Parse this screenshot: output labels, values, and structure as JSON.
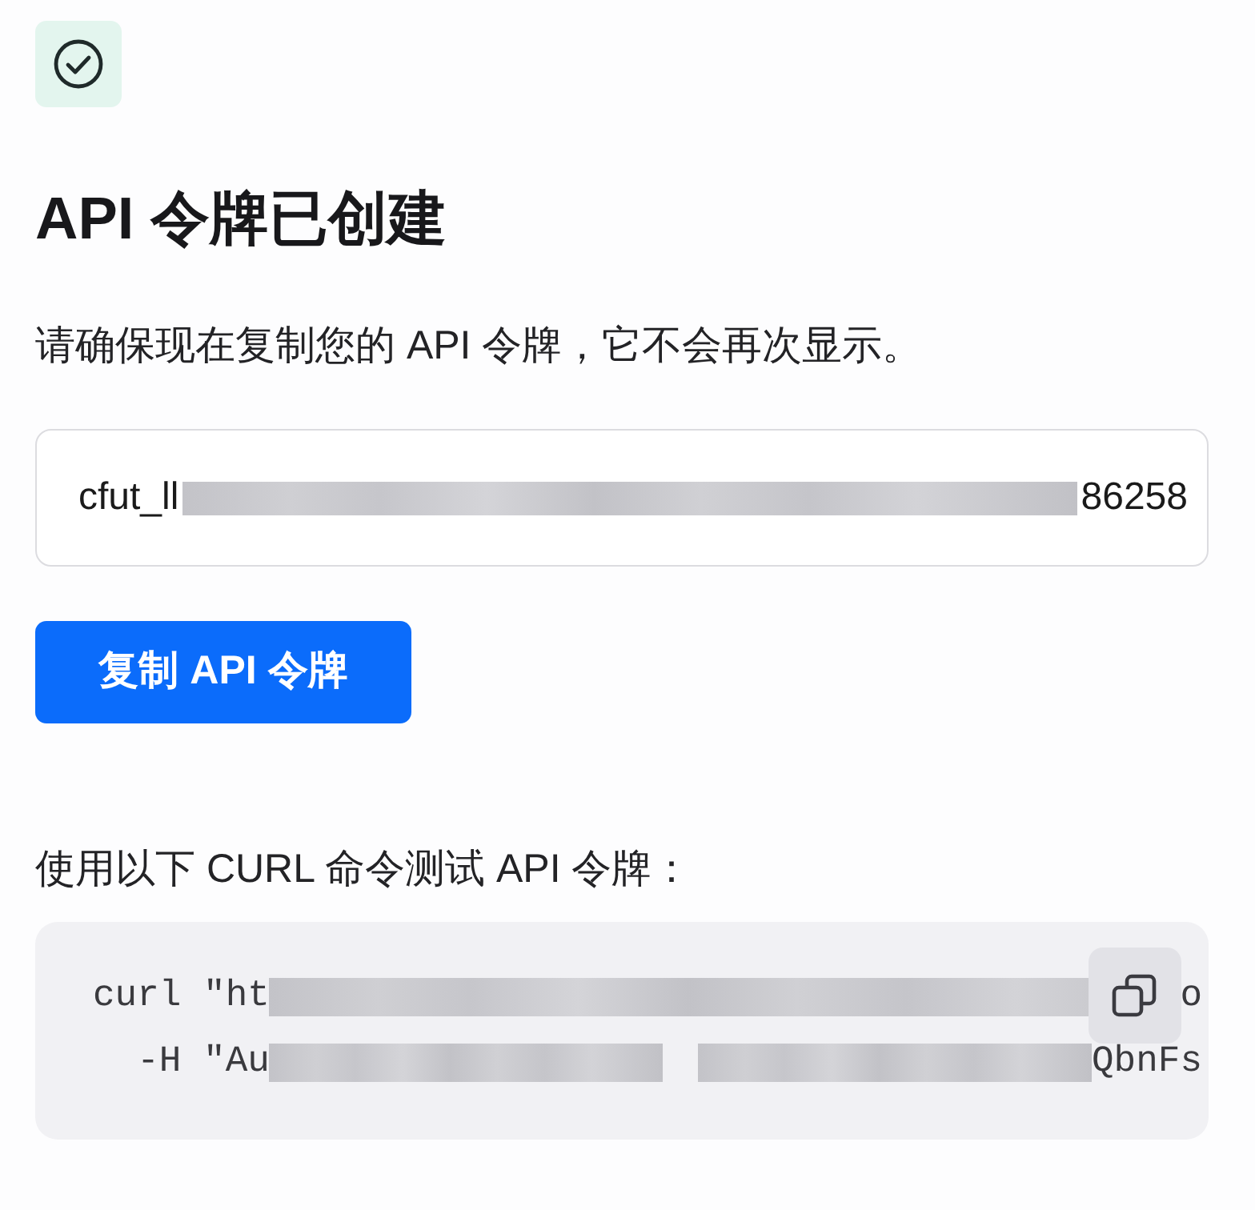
{
  "title": "API 令牌已创建",
  "message": "请确保现在复制您的 API 令牌，它不会再次显示。",
  "token_field": {
    "segments": [
      {
        "kind": "text",
        "text": "cfut_ll"
      },
      {
        "kind": "redacted"
      },
      {
        "kind": "text",
        "text": "86258"
      }
    ]
  },
  "copy_token_button": "复制 API 令牌",
  "curl_label": "使用以下 CURL 命令测试 API 令牌：",
  "code_block": {
    "lines": [
      {
        "segments": [
          {
            "kind": "text",
            "text": "curl \"ht"
          },
          {
            "kind": "redacted"
          },
          {
            "kind": "text",
            "text": "o"
          }
        ]
      },
      {
        "segments": [
          {
            "kind": "text",
            "text": "  -H \"Au"
          },
          {
            "kind": "redacted"
          },
          {
            "kind": "redacted"
          },
          {
            "kind": "text",
            "text": "QbnFs"
          }
        ]
      }
    ]
  }
}
